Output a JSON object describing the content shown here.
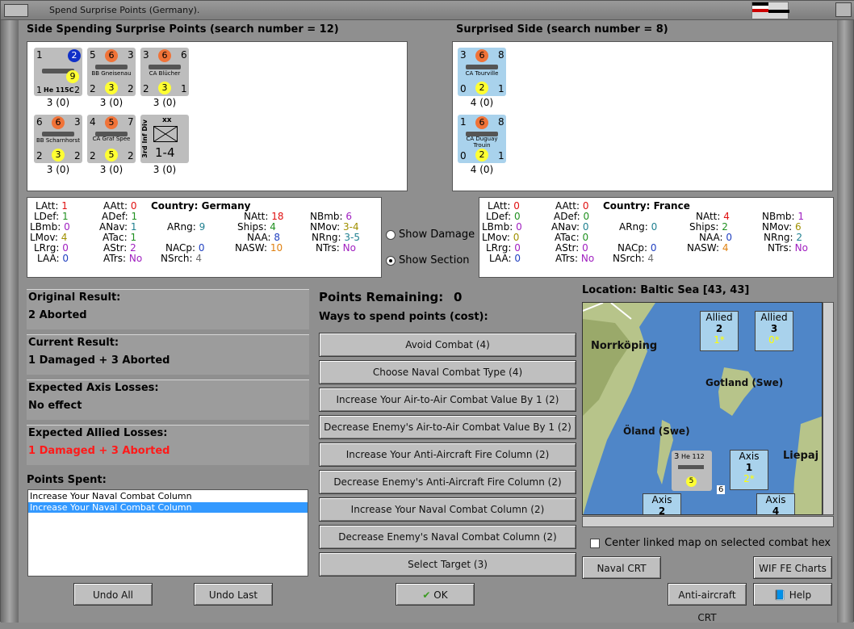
{
  "window": {
    "title": "Spend Surprise Points (Germany)."
  },
  "left_side": {
    "header": "Side Spending Surprise Points (search number = 12)",
    "units": [
      {
        "tl": "1",
        "circle": "2",
        "bl": "1",
        "br": "2",
        "name": "He 115C",
        "yc": "9",
        "cap": "3 (0)"
      },
      {
        "tl": "5",
        "circle": "6",
        "tr": "3",
        "bl": "2",
        "br": "2",
        "name": "BB Gneisenau",
        "yc": "3",
        "cap": "3 (0)"
      },
      {
        "tl": "3",
        "circle": "6",
        "tr": "6",
        "bl": "2",
        "br": "1",
        "name": "CA Blücher",
        "yc": "3",
        "cap": "3 (0)"
      },
      {
        "tl": "6",
        "circle": "6",
        "tr": "3",
        "bl": "2",
        "br": "2",
        "name": "BB Scharnhorst",
        "yc": "3",
        "cap": "3 (0)"
      },
      {
        "tl": "4",
        "circle": "5",
        "tr": "7",
        "bl": "2",
        "br": "2",
        "name": "CA Graf Spee",
        "yc": "5",
        "cap": "3 (0)"
      },
      {
        "side": "3rd Inf Div",
        "top": "xx",
        "val": "1-4",
        "cap": "3 (0)"
      }
    ]
  },
  "right_side": {
    "header": "Surprised Side (search number = 8)",
    "units": [
      {
        "tl": "3",
        "circle": "6",
        "tr": "8",
        "bl": "0",
        "br": "1",
        "name": "CA Tourville",
        "yc": "2",
        "cap": "4 (0)"
      },
      {
        "tl": "1",
        "circle": "6",
        "tr": "8",
        "bl": "0",
        "br": "1",
        "name": "CA Duguay Trouin",
        "yc": "2",
        "cap": "4 (0)"
      }
    ]
  },
  "germany_stats": {
    "country_label": "Country: Germany",
    "latt": "1",
    "ldef": "1",
    "lbmb": "0",
    "lmov": "4",
    "lrng": "0",
    "laa": "0",
    "aatt": "0",
    "adef": "1",
    "anav": "1",
    "atac": "1",
    "astr": "2",
    "atrs": "No",
    "arng": "9",
    "nacp": "0",
    "nsrch": "4",
    "natt": "18",
    "ships": "4",
    "naa": "8",
    "nasw": "10",
    "nbmb": "6",
    "nmov": "3-4",
    "nrng": "3-5",
    "ntrs": "No"
  },
  "france_stats": {
    "country_label": "Country: France",
    "latt": "0",
    "ldef": "0",
    "lbmb": "0",
    "lmov": "0",
    "lrng": "0",
    "laa": "0",
    "aatt": "0",
    "adef": "0",
    "anav": "0",
    "atac": "0",
    "astr": "0",
    "atrs": "No",
    "arng": "0",
    "nacp": "0",
    "nsrch": "4",
    "natt": "4",
    "ships": "2",
    "naa": "0",
    "nasw": "4",
    "nbmb": "1",
    "nmov": "6",
    "nrng": "2",
    "ntrs": "No"
  },
  "stat_labels": {
    "latt": "LAtt:",
    "ldef": "LDef:",
    "lbmb": "LBmb:",
    "lmov": "LMov:",
    "lrng": "LRrg:",
    "laa": "LAA:",
    "aatt": "AAtt:",
    "adef": "ADef:",
    "anav": "ANav:",
    "atac": "ATac:",
    "astr": "AStr:",
    "atrs": "ATrs:",
    "arng": "ARng:",
    "nacp": "NACp:",
    "nsrch": "NSrch:",
    "natt": "NAtt:",
    "ships": "Ships:",
    "naa": "NAA:",
    "nasw": "NASW:",
    "nbmb": "NBmb:",
    "nmov": "NMov:",
    "nrng": "NRng:",
    "ntrs": "NTrs:"
  },
  "options": {
    "show_damage": "Show Damage",
    "show_section": "Show Section"
  },
  "results": {
    "original_title": "Original Result:",
    "original_value": "2 Aborted",
    "current_title": "Current Result:",
    "current_value": "1 Damaged + 3 Aborted",
    "axis_title": "Expected Axis Losses:",
    "axis_value": "No effect",
    "allied_title": "Expected Allied Losses:",
    "allied_value": "1 Damaged + 3 Aborted"
  },
  "points_spent": {
    "title": "Points Spent:",
    "items": [
      "Increase Your Naval Combat Column",
      "Increase Your Naval Combat Column"
    ]
  },
  "spend": {
    "remaining_label": "Points Remaining:",
    "remaining_value": "0",
    "ways_label": "Ways to spend points (cost):",
    "buttons": [
      "Avoid Combat (4)",
      "Choose Naval Combat Type (4)",
      "Increase Your Air-to-Air Combat Value By 1 (2)",
      "Decrease Enemy's Air-to-Air Combat Value By 1 (2)",
      "Increase Your Anti-Aircraft Fire Column (2)",
      "Decrease Enemy's Anti-Aircraft Fire Column (2)",
      "Increase Your Naval Combat Column (2)",
      "Decrease Enemy's Naval Combat Column (2)",
      "Select Target (3)"
    ]
  },
  "map": {
    "location": "Location: Baltic Sea [43, 43]",
    "labels": {
      "norrkoping": "Norrköping",
      "gotland": "Gotland (Swe)",
      "oland": "Öland (Swe)",
      "liepaja": "Liepaj"
    },
    "allied1": {
      "side": "Allied",
      "n": "2",
      "s": "1*"
    },
    "allied2": {
      "side": "Allied",
      "n": "3",
      "s": "0*"
    },
    "axis1": {
      "side": "Axis",
      "n": "1",
      "s": "2*"
    },
    "axis2": {
      "side": "Axis",
      "n": "2"
    },
    "axis3": {
      "side": "Axis",
      "n": "4"
    },
    "he112": {
      "tl": "3",
      "name": "He 112",
      "yc": "5",
      "below": "6"
    },
    "center_link": "Center linked map on selected combat hex"
  },
  "footer": {
    "undo_all": "Undo All",
    "undo_last": "Undo Last",
    "ok": "OK",
    "naval_crt": "Naval CRT",
    "wif_fe": "WIF FE Charts",
    "aa_crt": "Anti-aircraft CRT",
    "help": "Help"
  }
}
